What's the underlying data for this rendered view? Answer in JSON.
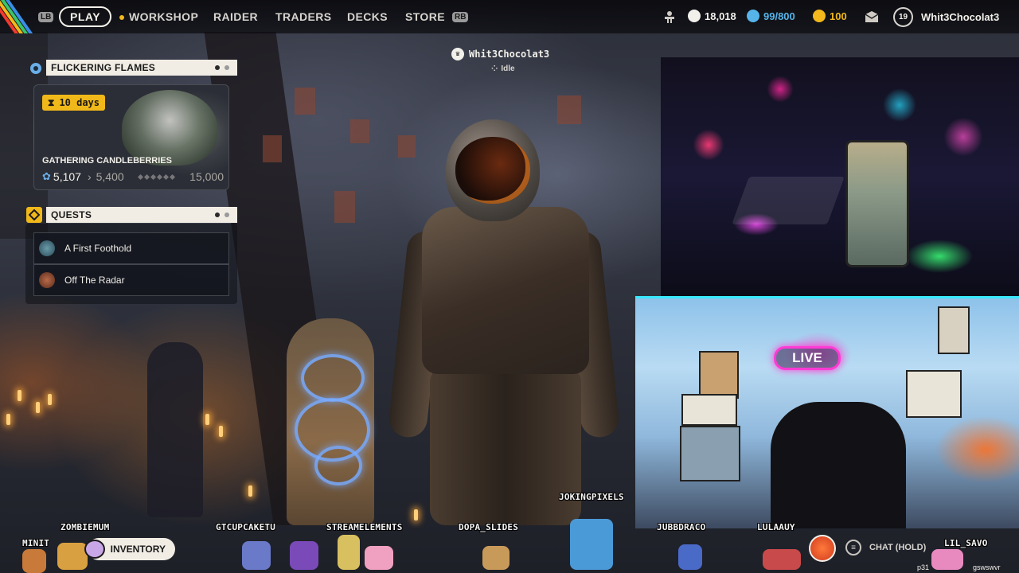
{
  "topbar": {
    "lb": "LB",
    "rb": "RB",
    "play": "PLAY",
    "nav": [
      "WORKSHOP",
      "RAIDER",
      "TRADERS",
      "DECKS",
      "STORE"
    ],
    "currency_1": "18,018",
    "currency_2": "99/800",
    "currency_3": "100",
    "level": "19",
    "username": "Whit3Chocolat3",
    "colors": {
      "currency_1": "#f2f0ea",
      "currency_2": "#56b4e9",
      "currency_3": "#f2b81c",
      "stripes": [
        "#f03a2e",
        "#f2b81c",
        "#3cc46a",
        "#3a8ee6"
      ]
    }
  },
  "event": {
    "title": "FLICKERING FLAMES",
    "timer": "10 days",
    "subtitle": "GATHERING CANDLEBERRIES",
    "current": "5,107",
    "next": "5,400",
    "max": "15,000"
  },
  "quests": {
    "title": "QUESTS",
    "items": [
      {
        "label": "A First Foothold",
        "avatar_color": "#3a6a7a"
      },
      {
        "label": "Off The Radar",
        "avatar_color": "#7a3a2a"
      }
    ]
  },
  "center": {
    "name": "Whit3Chocolat3",
    "status": "Idle"
  },
  "chat_users": [
    "MINIT",
    "ZOMBIEMUM",
    "GTCUPCAKETU",
    "STREAMELEMENTS",
    "DOPA_SLIDES",
    "JOKINGPIXELS",
    "JUBBDRACO",
    "LULAAUY",
    "LIL_SAVO"
  ],
  "bottom": {
    "inventory": "INVENTORY",
    "chat_hold": "CHAT (HOLD)",
    "footer_text_1": "p31",
    "footer_text_2": "gswswvr"
  },
  "webcam": {
    "live_sign": "LIVE"
  }
}
